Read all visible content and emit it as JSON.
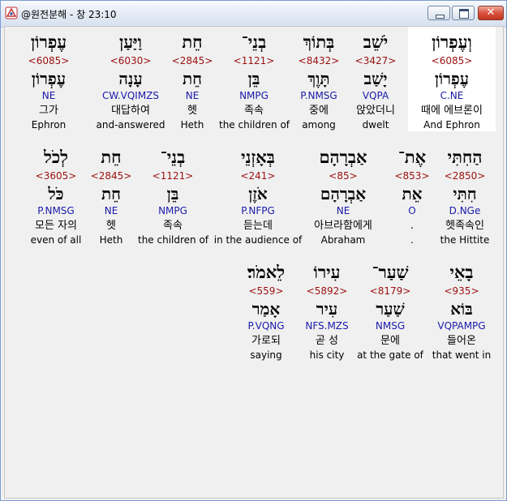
{
  "window": {
    "title": "@원전분해 - 창 23:10",
    "close_glyph": "✕"
  },
  "rows": [
    [
      {
        "hebrew": "עֶפְרוֹן",
        "strong": "<6085>",
        "root": "עֶפְרוֹן",
        "parse": "NE",
        "korean": "그가",
        "english": "Ephron"
      },
      {
        "hebrew": "וַיַּעַן",
        "strong": "<6030>",
        "root": "עָנָה",
        "parse": "CW.VQIMZS",
        "korean": "대답하여",
        "english": "and-answered"
      },
      {
        "hebrew": "חֵת",
        "strong": "<2845>",
        "root": "חֵת",
        "parse": "NE",
        "korean": "헷",
        "english": "Heth"
      },
      {
        "hebrew": "בְנֵי־",
        "strong": "<1121>",
        "root": "בֵּן",
        "parse": "NMPG",
        "korean": "족속",
        "english": "the children of"
      },
      {
        "hebrew": "בְּתוֹךְ",
        "strong": "<8432>",
        "root": "תָּוֶךְ",
        "parse": "P.NMSG",
        "korean": "중에",
        "english": "among"
      },
      {
        "hebrew": "יֹשֵׁב",
        "strong": "<3427>",
        "root": "יָשַׁב",
        "parse": "VQPA",
        "korean": "앉았더니",
        "english": "dwelt"
      },
      {
        "hebrew": "וְעֶפְרוֹן",
        "strong": "<6085>",
        "root": "עֶפְרוֹן",
        "parse": "C.NE",
        "korean": "때에 에브론이",
        "english": "And Ephron",
        "highlight": true
      }
    ],
    [
      {
        "hebrew": "לְכֹל",
        "strong": "<3605>",
        "root": "כֹּל",
        "parse": "P.NMSG",
        "korean": "모든 자의",
        "english": "even of all"
      },
      {
        "hebrew": "חֵת",
        "strong": "<2845>",
        "root": "חֵת",
        "parse": "NE",
        "korean": "헷",
        "english": "Heth"
      },
      {
        "hebrew": "בְנֵי־",
        "strong": "<1121>",
        "root": "בֵּן",
        "parse": "NMPG",
        "korean": "족속",
        "english": "the children of"
      },
      {
        "hebrew": "בְּאָזְנֵי",
        "strong": "<241>",
        "root": "אֹזֶן",
        "parse": "P.NFPG",
        "korean": "듣는데",
        "english": "in the audience of"
      },
      {
        "hebrew": "אַבְרָהָם",
        "strong": "<85>",
        "root": "אַבְרָהָם",
        "parse": "NE",
        "korean": "아브라함에게",
        "english": "Abraham"
      },
      {
        "hebrew": "אֶת־",
        "strong": "<853>",
        "root": "אֵת",
        "parse": "O",
        "korean": ".",
        "english": "."
      },
      {
        "hebrew": "הַחִתִּי",
        "strong": "<2850>",
        "root": "חִתִּי",
        "parse": "D.NGe",
        "korean": "헷족속인",
        "english": "the Hittite"
      }
    ],
    [
      {
        "hebrew": "לֵאמֹר׃",
        "strong": "<559>",
        "root": "אָמַר",
        "parse": "P.VQNG",
        "korean": "가로되",
        "english": "saying"
      },
      {
        "hebrew": "עִירוֹ",
        "strong": "<5892>",
        "root": "עִיר",
        "parse": "NFS.MZS",
        "korean": "곧 성",
        "english": "his city"
      },
      {
        "hebrew": "שַׁעַר־",
        "strong": "<8179>",
        "root": "שַׁעַר",
        "parse": "NMSG",
        "korean": "문에",
        "english": "at the gate of"
      },
      {
        "hebrew": "בָאֵי",
        "strong": "<935>",
        "root": "בּוֹא",
        "parse": "VQPAMPG",
        "korean": "들어온",
        "english": "that went in"
      }
    ]
  ]
}
